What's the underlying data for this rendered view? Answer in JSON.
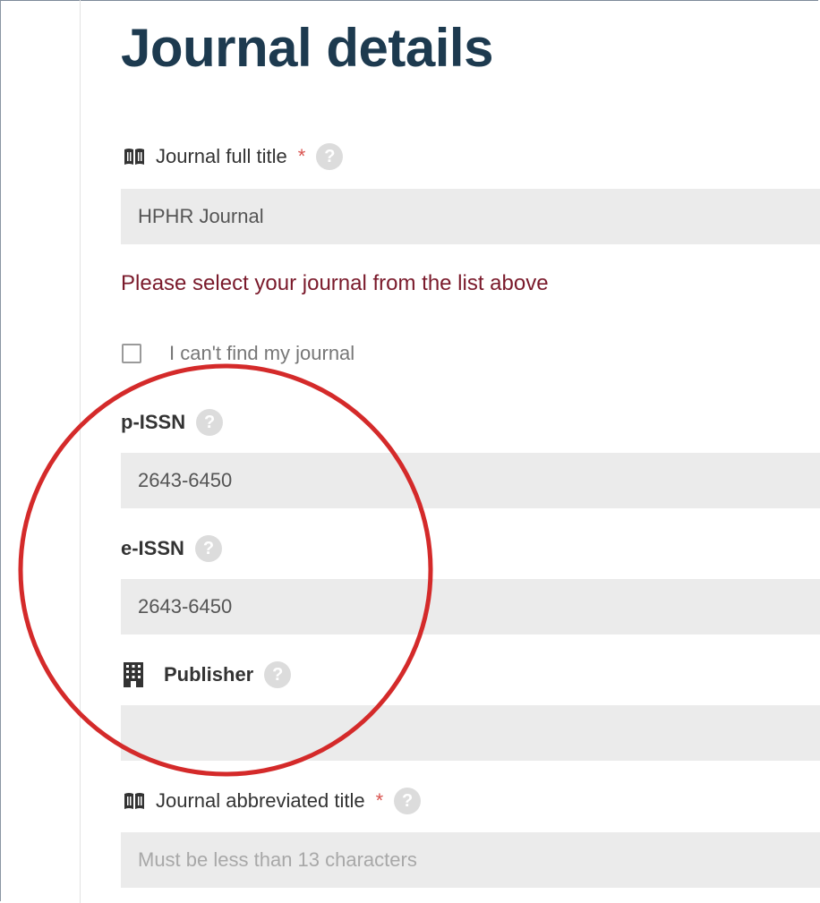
{
  "page": {
    "title": "Journal details"
  },
  "fields": {
    "full_title": {
      "label": "Journal full title",
      "required_mark": "*",
      "help": "?",
      "value": "HPHR Journal",
      "icon": "book-icon"
    },
    "error_message": "Please select your journal from the list above",
    "cant_find": {
      "label": "I can't find my journal",
      "checked": false
    },
    "p_issn": {
      "label": "p-ISSN",
      "help": "?",
      "value": "2643-6450"
    },
    "e_issn": {
      "label": "e-ISSN",
      "help": "?",
      "value": "2643-6450"
    },
    "publisher": {
      "label": "Publisher",
      "help": "?",
      "value": "",
      "icon": "building-icon"
    },
    "abbreviated_title": {
      "label": "Journal abbreviated title",
      "required_mark": "*",
      "help": "?",
      "value": "",
      "placeholder": "Must be less than 13 characters",
      "icon": "book-icon"
    }
  },
  "colors": {
    "title": "#1d3a4f",
    "error": "#7a1a2b",
    "required": "#d9534f",
    "annotation_circle": "#d42a2a",
    "input_bg": "#ebebeb"
  }
}
